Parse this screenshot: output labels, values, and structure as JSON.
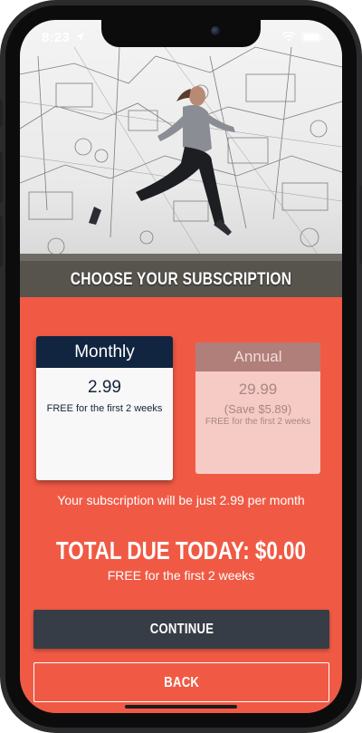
{
  "status_bar": {
    "time": "8:23",
    "icons": [
      "location-arrow-icon",
      "wifi-icon",
      "battery-icon"
    ]
  },
  "hero": {
    "title": "CHOOSE YOUR SUBSCRIPTION",
    "image": "woman-running-photo"
  },
  "plans": {
    "monthly": {
      "name": "Monthly",
      "price": "2.99",
      "note": "FREE for the first 2 weeks",
      "selected": true
    },
    "annual": {
      "name": "Annual",
      "price": "29.99",
      "savings": "(Save $5.89)",
      "note": "FREE for the first 2 weeks",
      "selected": false
    }
  },
  "summary": {
    "notice": "Your subscription will be just 2.99 per month",
    "total": "TOTAL DUE TODAY: $0.00",
    "total_note": "FREE for the first 2 weeks"
  },
  "buttons": {
    "continue": "CONTINUE",
    "back": "BACK"
  },
  "colors": {
    "accent": "#f05a45",
    "selected_header": "#112440",
    "continue_button": "#373d46"
  }
}
